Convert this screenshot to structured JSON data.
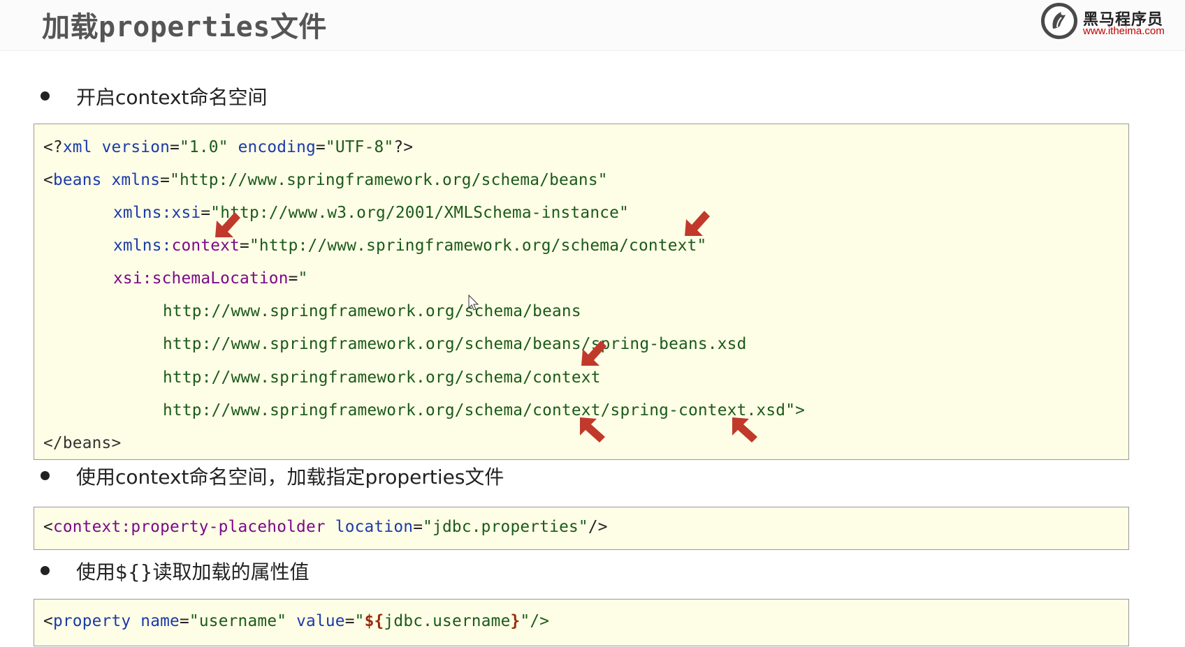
{
  "header": {
    "title": "加载properties文件",
    "logo_name": "黑马程序员",
    "logo_url": "www.itheima.com"
  },
  "bullets": [
    "开启context命名空间",
    "使用context命名空间，加载指定properties文件",
    "使用${}读取加载的属性值"
  ],
  "code1": {
    "xml_decl": {
      "open": "<?",
      "name": "xml",
      "a1": "version",
      "v1": "\"1.0\"",
      "a2": "encoding",
      "v2": "\"UTF-8\"",
      "close": "?>"
    },
    "beans_open": {
      "lt": "<",
      "name": "beans",
      "attr": "xmlns",
      "val": "\"http://www.springframework.org/schema/beans\""
    },
    "xsi": {
      "attr": "xmlns:xsi",
      "val": "\"http://www.w3.org/2001/XMLSchema-instance\""
    },
    "context": {
      "attr_prefix": "xmlns:",
      "attr_name": "context",
      "val": "\"http://www.springframework.org/schema/context\""
    },
    "schema_location": {
      "attr": "xsi:schemaLocation",
      "val": "\""
    },
    "schema_urls": [
      "http://www.springframework.org/schema/beans",
      "http://www.springframework.org/schema/beans/spring-beans.xsd",
      "http://www.springframework.org/schema/context",
      "http://www.springframework.org/schema/context/spring-context.xsd\">"
    ],
    "beans_close": "</beans>"
  },
  "code2": {
    "lt": "<",
    "el": "context:property-placeholder",
    "attr": "location",
    "val": "\"jdbc.properties\"",
    "close": "/>"
  },
  "code3": {
    "lt": "<",
    "el": "property",
    "a1": "name",
    "v1": "\"username\"",
    "a2": "value",
    "q": "\"",
    "expr_open": "${",
    "expr_body": "jdbc.username",
    "expr_close": "}",
    "close": "\"/>"
  },
  "colors": {
    "code_bg": "#fefde6",
    "arrow": "#c0392b",
    "logo_url": "#c00000"
  }
}
